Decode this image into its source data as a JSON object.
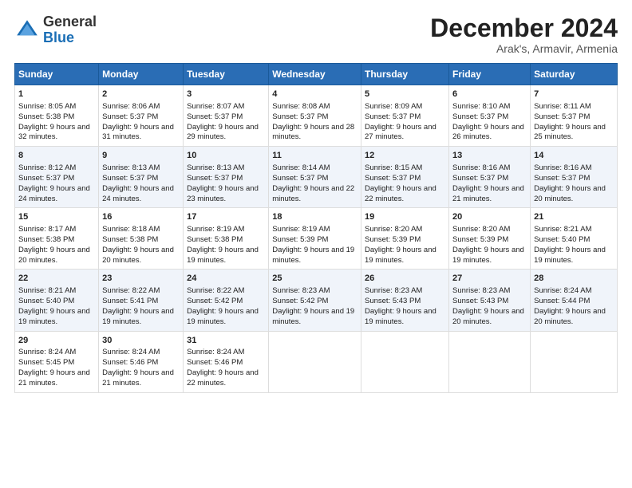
{
  "logo": {
    "general": "General",
    "blue": "Blue"
  },
  "title": "December 2024",
  "subtitle": "Arak's, Armavir, Armenia",
  "days_of_week": [
    "Sunday",
    "Monday",
    "Tuesday",
    "Wednesday",
    "Thursday",
    "Friday",
    "Saturday"
  ],
  "weeks": [
    [
      {
        "day": "1",
        "sunrise": "8:05 AM",
        "sunset": "5:38 PM",
        "daylight": "9 hours and 32 minutes."
      },
      {
        "day": "2",
        "sunrise": "8:06 AM",
        "sunset": "5:37 PM",
        "daylight": "9 hours and 31 minutes."
      },
      {
        "day": "3",
        "sunrise": "8:07 AM",
        "sunset": "5:37 PM",
        "daylight": "9 hours and 29 minutes."
      },
      {
        "day": "4",
        "sunrise": "8:08 AM",
        "sunset": "5:37 PM",
        "daylight": "9 hours and 28 minutes."
      },
      {
        "day": "5",
        "sunrise": "8:09 AM",
        "sunset": "5:37 PM",
        "daylight": "9 hours and 27 minutes."
      },
      {
        "day": "6",
        "sunrise": "8:10 AM",
        "sunset": "5:37 PM",
        "daylight": "9 hours and 26 minutes."
      },
      {
        "day": "7",
        "sunrise": "8:11 AM",
        "sunset": "5:37 PM",
        "daylight": "9 hours and 25 minutes."
      }
    ],
    [
      {
        "day": "8",
        "sunrise": "8:12 AM",
        "sunset": "5:37 PM",
        "daylight": "9 hours and 24 minutes."
      },
      {
        "day": "9",
        "sunrise": "8:13 AM",
        "sunset": "5:37 PM",
        "daylight": "9 hours and 24 minutes."
      },
      {
        "day": "10",
        "sunrise": "8:13 AM",
        "sunset": "5:37 PM",
        "daylight": "9 hours and 23 minutes."
      },
      {
        "day": "11",
        "sunrise": "8:14 AM",
        "sunset": "5:37 PM",
        "daylight": "9 hours and 22 minutes."
      },
      {
        "day": "12",
        "sunrise": "8:15 AM",
        "sunset": "5:37 PM",
        "daylight": "9 hours and 22 minutes."
      },
      {
        "day": "13",
        "sunrise": "8:16 AM",
        "sunset": "5:37 PM",
        "daylight": "9 hours and 21 minutes."
      },
      {
        "day": "14",
        "sunrise": "8:16 AM",
        "sunset": "5:37 PM",
        "daylight": "9 hours and 20 minutes."
      }
    ],
    [
      {
        "day": "15",
        "sunrise": "8:17 AM",
        "sunset": "5:38 PM",
        "daylight": "9 hours and 20 minutes."
      },
      {
        "day": "16",
        "sunrise": "8:18 AM",
        "sunset": "5:38 PM",
        "daylight": "9 hours and 20 minutes."
      },
      {
        "day": "17",
        "sunrise": "8:19 AM",
        "sunset": "5:38 PM",
        "daylight": "9 hours and 19 minutes."
      },
      {
        "day": "18",
        "sunrise": "8:19 AM",
        "sunset": "5:39 PM",
        "daylight": "9 hours and 19 minutes."
      },
      {
        "day": "19",
        "sunrise": "8:20 AM",
        "sunset": "5:39 PM",
        "daylight": "9 hours and 19 minutes."
      },
      {
        "day": "20",
        "sunrise": "8:20 AM",
        "sunset": "5:39 PM",
        "daylight": "9 hours and 19 minutes."
      },
      {
        "day": "21",
        "sunrise": "8:21 AM",
        "sunset": "5:40 PM",
        "daylight": "9 hours and 19 minutes."
      }
    ],
    [
      {
        "day": "22",
        "sunrise": "8:21 AM",
        "sunset": "5:40 PM",
        "daylight": "9 hours and 19 minutes."
      },
      {
        "day": "23",
        "sunrise": "8:22 AM",
        "sunset": "5:41 PM",
        "daylight": "9 hours and 19 minutes."
      },
      {
        "day": "24",
        "sunrise": "8:22 AM",
        "sunset": "5:42 PM",
        "daylight": "9 hours and 19 minutes."
      },
      {
        "day": "25",
        "sunrise": "8:23 AM",
        "sunset": "5:42 PM",
        "daylight": "9 hours and 19 minutes."
      },
      {
        "day": "26",
        "sunrise": "8:23 AM",
        "sunset": "5:43 PM",
        "daylight": "9 hours and 19 minutes."
      },
      {
        "day": "27",
        "sunrise": "8:23 AM",
        "sunset": "5:43 PM",
        "daylight": "9 hours and 20 minutes."
      },
      {
        "day": "28",
        "sunrise": "8:24 AM",
        "sunset": "5:44 PM",
        "daylight": "9 hours and 20 minutes."
      }
    ],
    [
      {
        "day": "29",
        "sunrise": "8:24 AM",
        "sunset": "5:45 PM",
        "daylight": "9 hours and 21 minutes."
      },
      {
        "day": "30",
        "sunrise": "8:24 AM",
        "sunset": "5:46 PM",
        "daylight": "9 hours and 21 minutes."
      },
      {
        "day": "31",
        "sunrise": "8:24 AM",
        "sunset": "5:46 PM",
        "daylight": "9 hours and 22 minutes."
      },
      null,
      null,
      null,
      null
    ]
  ]
}
